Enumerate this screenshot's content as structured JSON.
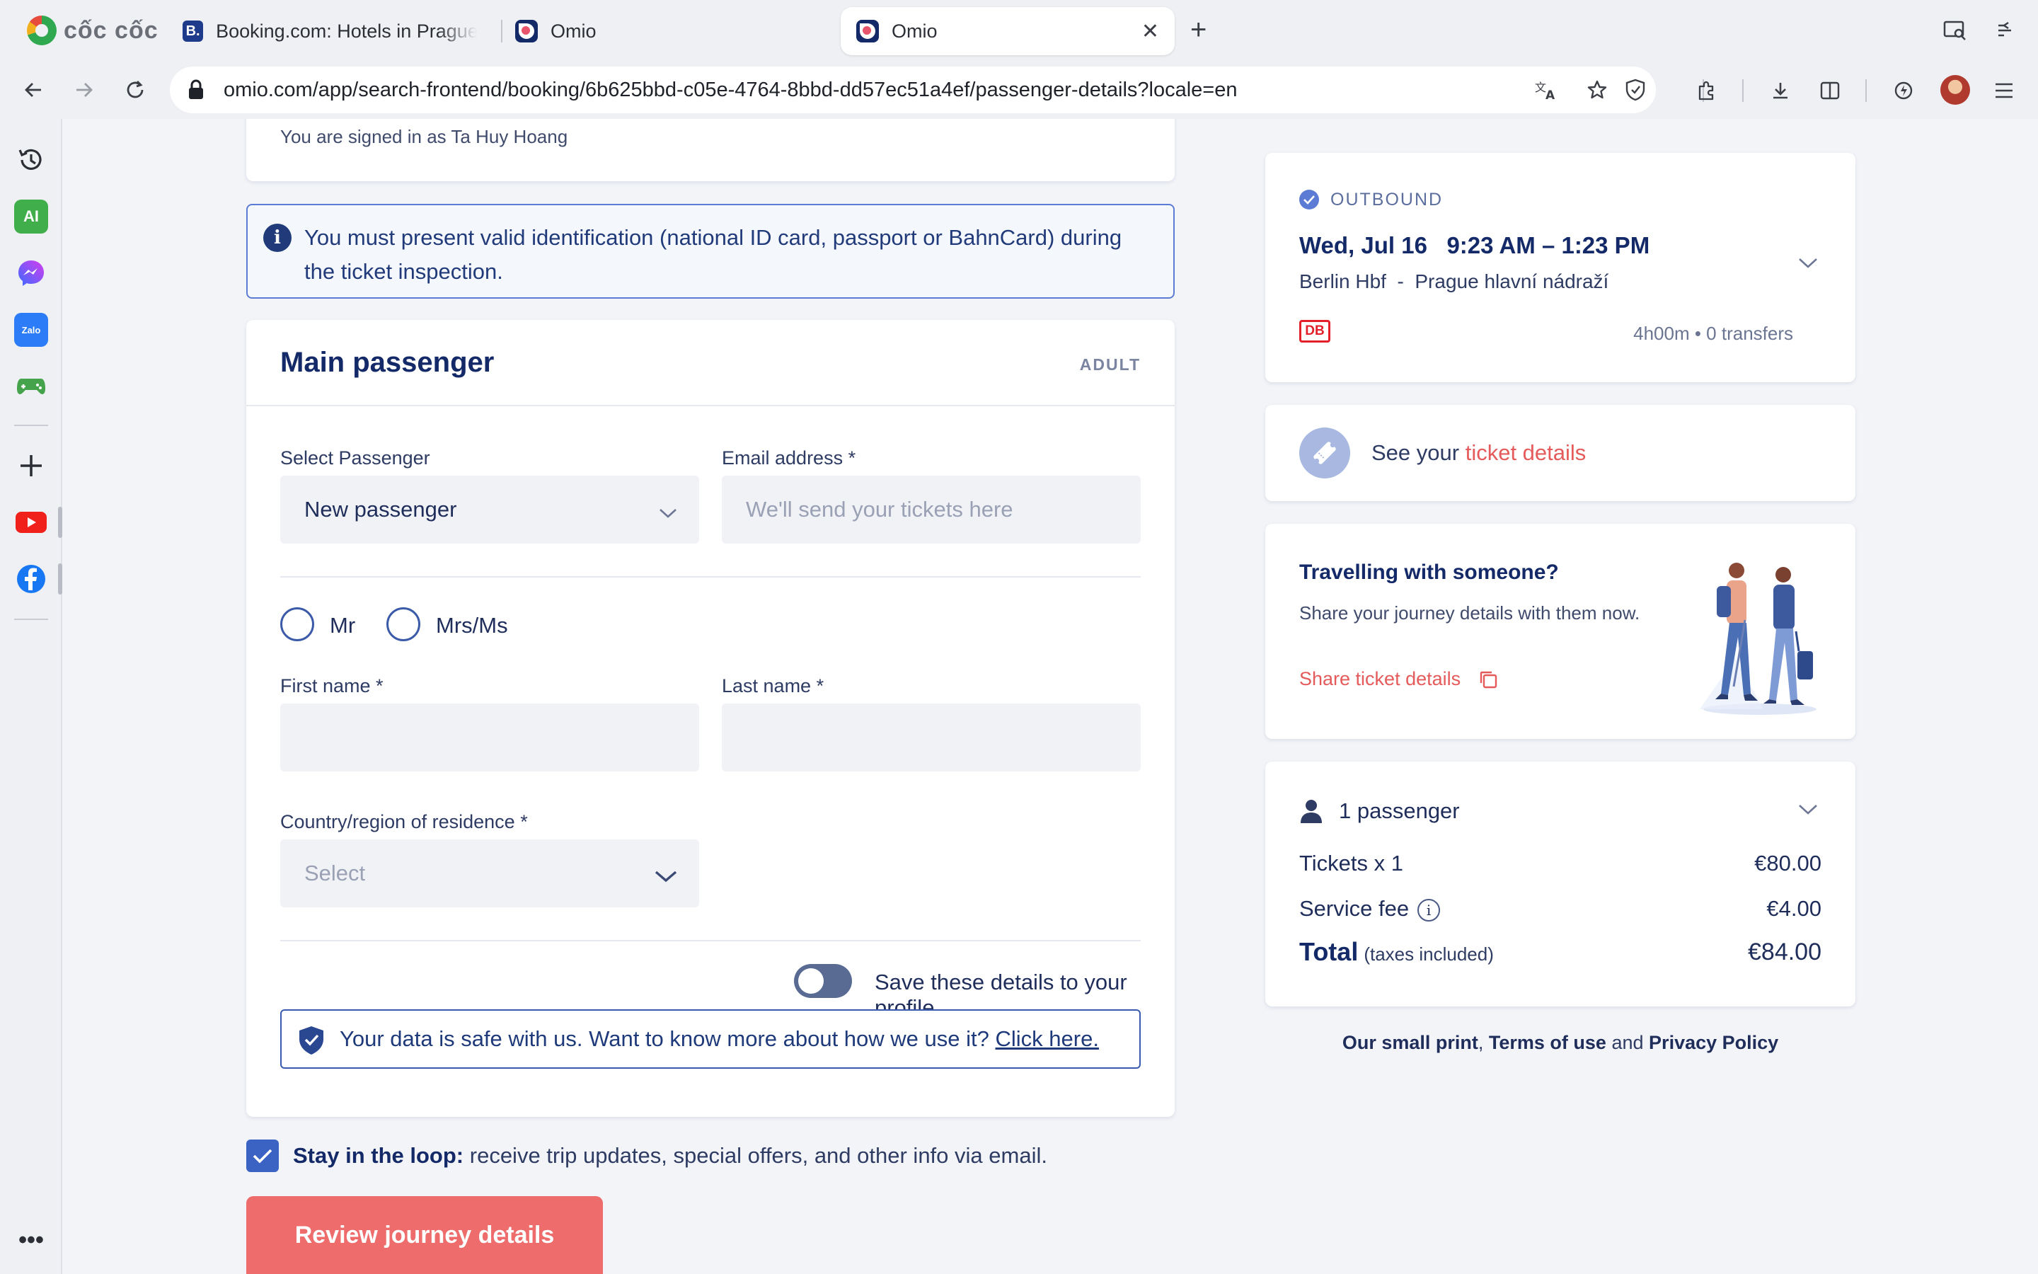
{
  "browser": {
    "brand": "cốc cốc",
    "tabs": [
      {
        "title": "Booking.com: Hotels in Prague",
        "favicon": "B."
      },
      {
        "title": "Omio"
      },
      {
        "title": "Omio",
        "active": true
      }
    ],
    "url": "omio.com/app/search-frontend/booking/6b625bbd-c05e-4764-8bbd-dd57ec51a4ef/passenger-details?locale=en"
  },
  "sidebar": {
    "items": [
      "history-icon",
      "ai-icon",
      "messenger-icon",
      "zalo-icon",
      "games-icon",
      "add-icon",
      "youtube-icon",
      "facebook-icon"
    ],
    "ai_label": "AI",
    "zalo_label": "Zalo"
  },
  "page": {
    "signed_in": "You are signed in as Ta Huy Hoang",
    "info_notice": "You must present valid identification (national ID card, passport or BahnCard) during the ticket inspection.",
    "passenger": {
      "title": "Main passenger",
      "badge": "ADULT",
      "select_label": "Select Passenger",
      "select_value": "New passenger",
      "email_label": "Email address *",
      "email_placeholder": "We'll send your tickets here",
      "title_options": [
        "Mr",
        "Mrs/Ms"
      ],
      "first_name_label": "First name *",
      "last_name_label": "Last name *",
      "country_label": "Country/region of residence *",
      "country_placeholder": "Select",
      "save_toggle_label": "Save these details to your profile",
      "safe_text": "Your data is safe with us. Want to know more about how we use it?",
      "safe_link": "Click here."
    },
    "loop_bold": "Stay in the loop:",
    "loop_text": "receive trip updates, special offers, and other info via email.",
    "cta": "Review journey details"
  },
  "summary": {
    "outbound_label": "OUTBOUND",
    "date_time": "Wed, Jul 16   9:23 AM – 1:23 PM",
    "route": "Berlin Hbf  -  Prague hlavní nádraží",
    "operator": "DB",
    "duration": "4h00m • 0 transfers",
    "ticket_prefix": "See your",
    "ticket_link": "ticket details",
    "travel_title": "Travelling with someone?",
    "travel_desc": "Share your journey details with them now.",
    "travel_share": "Share ticket details",
    "passengers": "1 passenger",
    "tickets_label": "Tickets x 1",
    "tickets_value": "€80.00",
    "fee_label": "Service fee",
    "fee_value": "€4.00",
    "total_label": "Total",
    "total_taxes": "(taxes included)",
    "total_value": "€84.00",
    "small_print": "Our small print",
    "terms": "Terms of use",
    "and": "and",
    "privacy": "Privacy Policy"
  },
  "colors": {
    "navy": "#132968",
    "coral": "#ee6c6c",
    "link": "#e55a5a",
    "accent_blue": "#3a63c4"
  }
}
